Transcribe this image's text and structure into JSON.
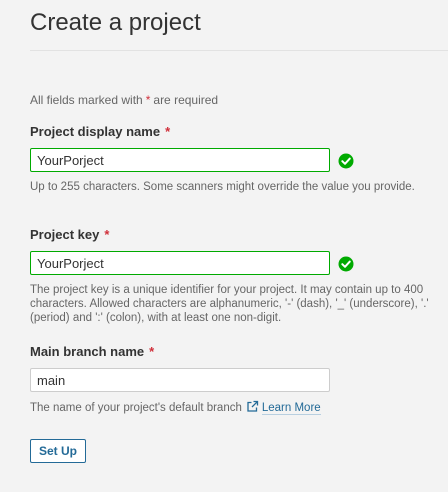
{
  "page": {
    "title": "Create a project"
  },
  "form": {
    "required_note_before": "All fields marked with",
    "required_marker": "*",
    "required_note_after": "are required",
    "display_name": {
      "label": "Project display name",
      "value": "YourPorject",
      "help": "Up to 255 characters. Some scanners might override the value you provide.",
      "status": "valid"
    },
    "project_key": {
      "label": "Project key",
      "value": "YourPorject",
      "help": "The project key is a unique identifier for your project. It may contain up to 400 characters. Allowed characters are alphanumeric, '-' (dash), '_' (underscore), '.' (period) and ':' (colon), with at least one non-digit.",
      "status": "valid"
    },
    "main_branch": {
      "label": "Main branch name",
      "value": "main",
      "help": "The name of your project's default branch",
      "link_label": "Learn More"
    },
    "submit_label": "Set Up"
  },
  "colors": {
    "valid_green": "#00aa00",
    "required_red": "#d02f3a",
    "link_blue": "#236a97"
  },
  "icons": {
    "valid": "check-circle-icon",
    "external_link": "external-link-icon"
  }
}
